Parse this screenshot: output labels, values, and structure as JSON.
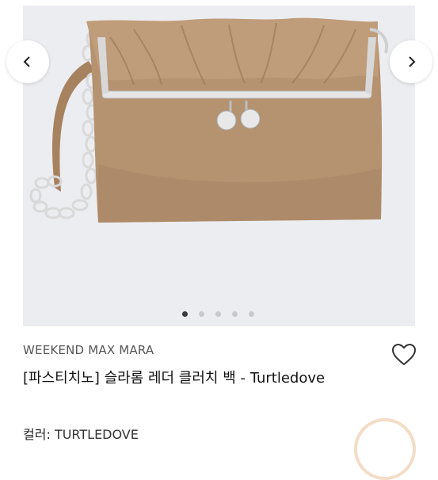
{
  "product": {
    "brand": "WEEKEND MAX MARA",
    "title": "[파스티치노] 슬라롬 레더 클러치 백 - Turtledove",
    "color_label": "컬러:",
    "color_value": "TURTLEDOVE"
  },
  "gallery": {
    "image_count": 5,
    "active_index": 0,
    "prev_icon": "chevron-left-icon",
    "next_icon": "chevron-right-icon",
    "colors": {
      "background": "#ecedf1",
      "leather": "#b3906f",
      "leather_dark": "#8e6d50",
      "metal": "#e3e3e3"
    }
  },
  "actions": {
    "wishlist_icon": "heart-outline-icon"
  }
}
